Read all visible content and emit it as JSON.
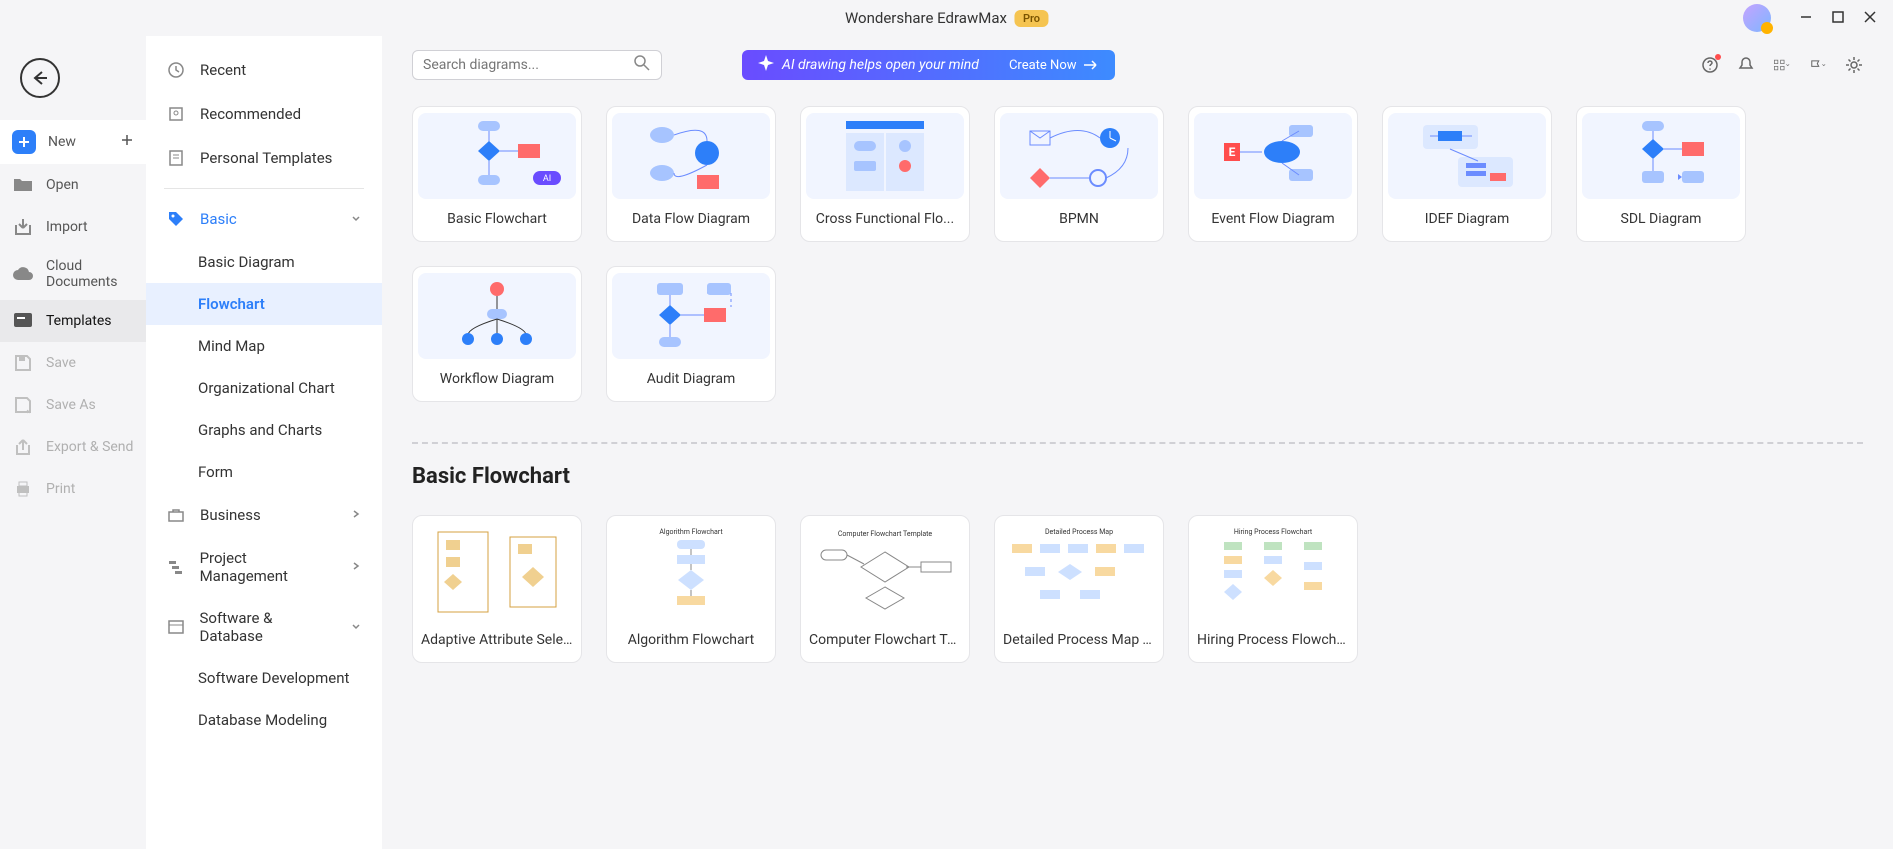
{
  "title": {
    "app": "Wondershare EdrawMax",
    "badge": "Pro"
  },
  "sidebar1": {
    "new": "New",
    "open": "Open",
    "import": "Import",
    "cloud": "Cloud Documents",
    "templates": "Templates",
    "save": "Save",
    "saveAs": "Save As",
    "export": "Export & Send",
    "print": "Print"
  },
  "sidebar2": {
    "recent": "Recent",
    "recommended": "Recommended",
    "personal": "Personal Templates",
    "basic": "Basic",
    "basic_sub": {
      "diagram": "Basic Diagram",
      "flowchart": "Flowchart",
      "mindmap": "Mind Map",
      "org": "Organizational Chart",
      "graphs": "Graphs and Charts",
      "form": "Form"
    },
    "business": "Business",
    "project": "Project Management",
    "software": "Software & Database",
    "software_sub": {
      "dev": "Software Development",
      "db": "Database Modeling"
    }
  },
  "search": {
    "placeholder": "Search diagrams..."
  },
  "ai": {
    "text": "AI drawing helps open your mind",
    "cta": "Create Now"
  },
  "grid1": [
    {
      "label": "Basic Flowchart"
    },
    {
      "label": "Data Flow Diagram"
    },
    {
      "label": "Cross Functional Flo..."
    },
    {
      "label": "BPMN"
    },
    {
      "label": "Event Flow Diagram"
    },
    {
      "label": "IDEF Diagram"
    },
    {
      "label": "SDL Diagram"
    },
    {
      "label": "Workflow Diagram"
    },
    {
      "label": "Audit Diagram"
    }
  ],
  "section2_title": "Basic Flowchart",
  "grid2": [
    {
      "label": "Adaptive Attribute Selecti..."
    },
    {
      "label": "Algorithm Flowchart"
    },
    {
      "label": "Computer Flowchart Temp..."
    },
    {
      "label": "Detailed Process Map Tem..."
    },
    {
      "label": "Hiring Process Flowchart"
    }
  ]
}
